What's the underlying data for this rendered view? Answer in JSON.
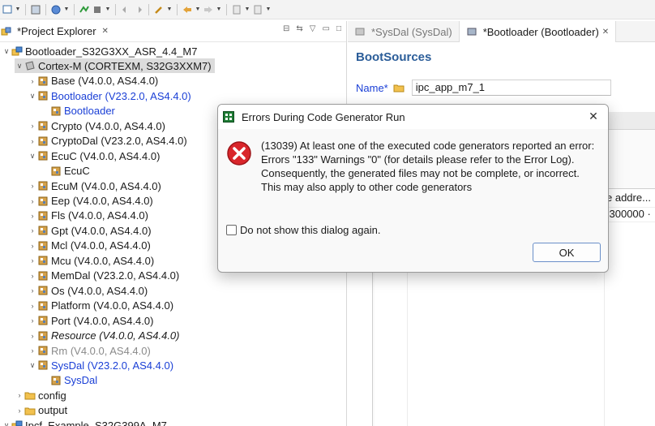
{
  "toolbar": {
    "icons": [
      "new-icon",
      "save-icon",
      "globe-icon",
      "run-icon",
      "build-icon",
      "undo-icon",
      "redo-icon",
      "tools-icon",
      "back-icon",
      "forward-icon",
      "nav-icon",
      "pin-icon"
    ]
  },
  "explorer": {
    "title": "*Project Explorer",
    "close": "✕",
    "tree": [
      {
        "label": "Bootloader_S32G3XX_ASR_4.4_M7",
        "depth": 0,
        "twisty": "∨",
        "icon": "project-icon",
        "style": ""
      },
      {
        "label": "Cortex-M (CORTEXM, S32G3XXM7)",
        "depth": 1,
        "twisty": "∨",
        "icon": "chip-icon",
        "style": "selected"
      },
      {
        "label": "Base (V4.0.0, AS4.4.0)",
        "depth": 2,
        "twisty": "›",
        "icon": "module-icon",
        "style": ""
      },
      {
        "label": "Bootloader (V23.2.0, AS4.4.0)",
        "depth": 2,
        "twisty": "∨",
        "icon": "module-icon",
        "style": "blue"
      },
      {
        "label": "Bootloader",
        "depth": 3,
        "twisty": "",
        "icon": "module-icon",
        "style": "blue"
      },
      {
        "label": "Crypto (V4.0.0, AS4.4.0)",
        "depth": 2,
        "twisty": "›",
        "icon": "module-icon",
        "style": ""
      },
      {
        "label": "CryptoDal (V23.2.0, AS4.4.0)",
        "depth": 2,
        "twisty": "›",
        "icon": "module-icon",
        "style": ""
      },
      {
        "label": "EcuC (V4.0.0, AS4.4.0)",
        "depth": 2,
        "twisty": "∨",
        "icon": "module-icon",
        "style": ""
      },
      {
        "label": "EcuC",
        "depth": 3,
        "twisty": "",
        "icon": "module-icon",
        "style": ""
      },
      {
        "label": "EcuM (V4.0.0, AS4.4.0)",
        "depth": 2,
        "twisty": "›",
        "icon": "module-icon",
        "style": ""
      },
      {
        "label": "Eep (V4.0.0, AS4.4.0)",
        "depth": 2,
        "twisty": "›",
        "icon": "module-icon",
        "style": ""
      },
      {
        "label": "Fls (V4.0.0, AS4.4.0)",
        "depth": 2,
        "twisty": "›",
        "icon": "module-icon",
        "style": ""
      },
      {
        "label": "Gpt (V4.0.0, AS4.4.0)",
        "depth": 2,
        "twisty": "›",
        "icon": "module-icon",
        "style": ""
      },
      {
        "label": "Mcl (V4.0.0, AS4.4.0)",
        "depth": 2,
        "twisty": "›",
        "icon": "module-icon",
        "style": ""
      },
      {
        "label": "Mcu (V4.0.0, AS4.4.0)",
        "depth": 2,
        "twisty": "›",
        "icon": "module-icon",
        "style": ""
      },
      {
        "label": "MemDal (V23.2.0, AS4.4.0)",
        "depth": 2,
        "twisty": "›",
        "icon": "module-icon",
        "style": ""
      },
      {
        "label": "Os (V4.0.0, AS4.4.0)",
        "depth": 2,
        "twisty": "›",
        "icon": "module-icon",
        "style": ""
      },
      {
        "label": "Platform (V4.0.0, AS4.4.0)",
        "depth": 2,
        "twisty": "›",
        "icon": "module-icon",
        "style": ""
      },
      {
        "label": "Port (V4.0.0, AS4.4.0)",
        "depth": 2,
        "twisty": "›",
        "icon": "module-icon",
        "style": ""
      },
      {
        "label": "Resource (V4.0.0, AS4.4.0)",
        "depth": 2,
        "twisty": "›",
        "icon": "module-icon",
        "style": "italic"
      },
      {
        "label": "Rm (V4.0.0, AS4.4.0)",
        "depth": 2,
        "twisty": "›",
        "icon": "module-icon",
        "style": "gray"
      },
      {
        "label": "SysDal (V23.2.0, AS4.4.0)",
        "depth": 2,
        "twisty": "∨",
        "icon": "module-icon",
        "style": "blue"
      },
      {
        "label": "SysDal",
        "depth": 3,
        "twisty": "",
        "icon": "module-icon",
        "style": "blue"
      },
      {
        "label": "config",
        "depth": 1,
        "twisty": "›",
        "icon": "folder-icon",
        "style": ""
      },
      {
        "label": "output",
        "depth": 1,
        "twisty": "›",
        "icon": "folder-icon",
        "style": ""
      },
      {
        "label": "Ipcf_Example_S32G399A_M7",
        "depth": 0,
        "twisty": "∨",
        "icon": "project-icon",
        "style": ""
      }
    ]
  },
  "editor": {
    "tabs": [
      {
        "label": "*SysDal (SysDal)",
        "active": false
      },
      {
        "label": "*Bootloader (Bootloader)",
        "active": true,
        "close": "✕"
      }
    ],
    "section_title": "BootSources",
    "name_label": "Name*",
    "name_value": "ipc_app_m7_1",
    "column_header": "e addre...",
    "selected_cell": "x300000 ·"
  },
  "dialog": {
    "title": "Errors During Code Generator Run",
    "close": "✕",
    "message": "(13039) At least one of the executed code generators reported an error: Errors \"133\" Warnings \"0\" (for details please refer to the Error Log). Consequently, the generated files may not be complete, or incorrect. This may also apply to other code generators",
    "checkbox_label": "Do not show this dialog again.",
    "ok_label": "OK"
  },
  "colors": {
    "accent_blue": "#1a3fd6",
    "title_blue": "#2b5d99",
    "error_red": "#d9262b",
    "selection_gray": "#dcdcdc"
  }
}
